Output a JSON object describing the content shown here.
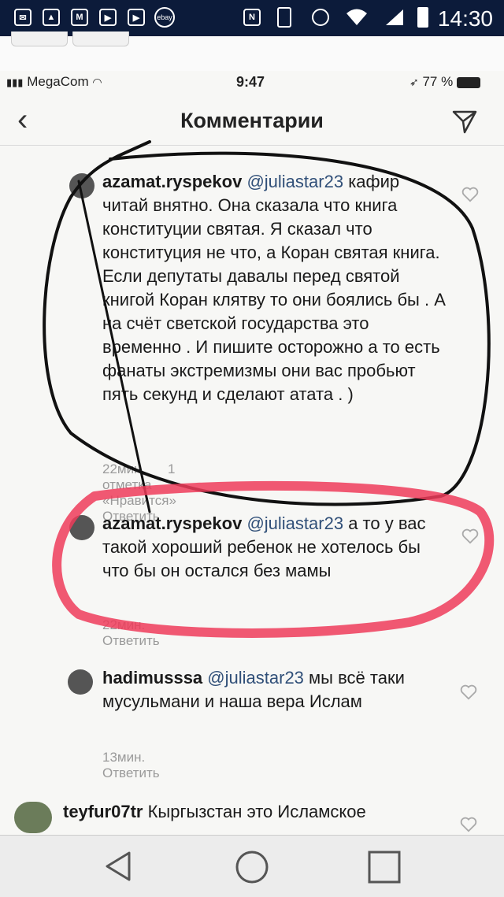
{
  "android_status": {
    "time": "14:30",
    "icons": [
      "mail-icon",
      "gallery-icon",
      "gmail-icon",
      "youtube-icon",
      "youtube-icon",
      "ebay-icon",
      "nfc-icon",
      "vibrate-icon",
      "alarm-icon",
      "wifi-icon",
      "signal-icon",
      "battery-icon"
    ],
    "ebay_label": "ebay"
  },
  "ios_status": {
    "carrier": "MegaCom",
    "time": "9:47",
    "battery": "77 %"
  },
  "header": {
    "title": "Комментарии",
    "back_icon": "chevron-left-icon",
    "send_icon": "paper-plane-icon"
  },
  "comments": [
    {
      "user": "azamat.ryspekov",
      "mention": "@juliastar23",
      "text": "кафир читай внятно. Она сказала что книга конституции святая. Я сказал что конституция не что,  а Коран святая книга. Если депутаты давалы перед святой книгой Коран клятву то они боялись бы . А на счёт светской государства это временно . И пишите осторожно а то есть фанаты экстремизмы они вас пробьют пять секунд и сделают атата . )",
      "time": "22мин.",
      "likes": "1 отметка «Нравится»",
      "reply": "Ответить"
    },
    {
      "user": "azamat.ryspekov",
      "mention": "@juliastar23",
      "text": "а то у вас такой хороший ребенок не хотелось бы что бы он остался без мамы",
      "time": "22мин.",
      "reply": "Ответить"
    },
    {
      "user": "hadimusssa",
      "mention": "@juliastar23",
      "text": "мы всё таки мусульмани и наша вера Ислам",
      "time": "13мин.",
      "reply": "Ответить"
    },
    {
      "user": "teyfur07tr",
      "text": "Кыргызстан это Исламское"
    }
  ],
  "annotations": {
    "ink_colors": {
      "black_circle": "#111111",
      "red_highlight": "#ee3c5a"
    }
  },
  "android_nav": {
    "back_icon": "triangle-back-icon",
    "home_icon": "circle-home-icon",
    "recents_icon": "square-recents-icon"
  }
}
